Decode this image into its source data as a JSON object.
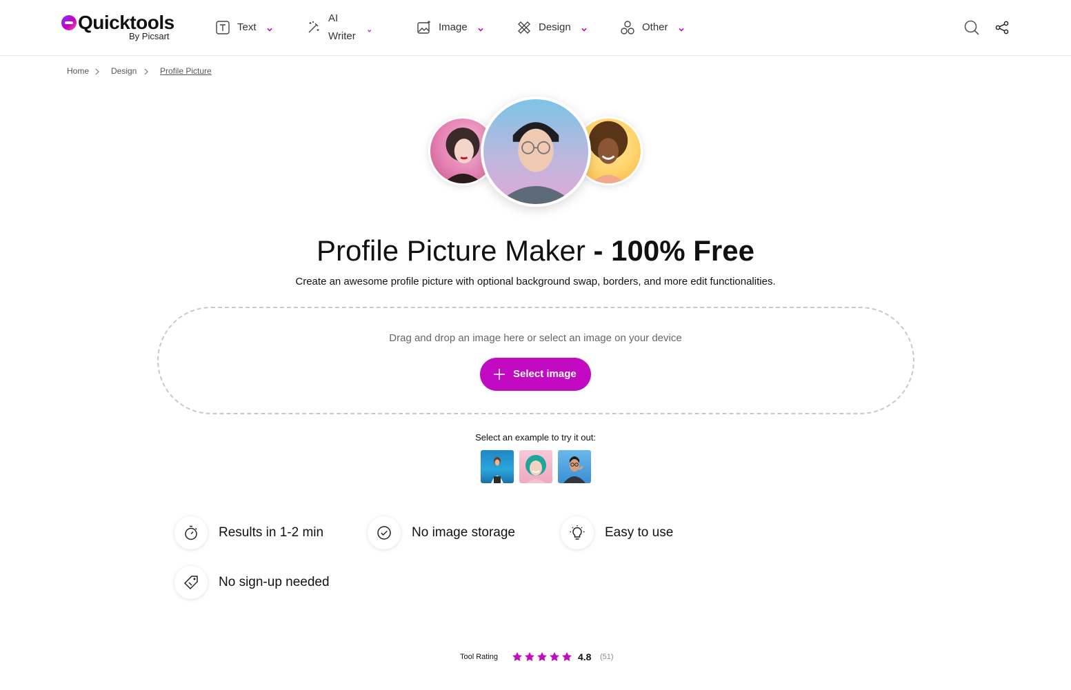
{
  "brand": {
    "name": "Quicktools",
    "sub": "By Picsart",
    "accent": "#c10ac1"
  },
  "nav": {
    "items": [
      {
        "label": "Text",
        "icon": "text-box-icon"
      },
      {
        "label": "AI Writer",
        "icon": "magic-wand-icon"
      },
      {
        "label": "Image",
        "icon": "image-sparkle-icon"
      },
      {
        "label": "Design",
        "icon": "design-tools-icon"
      },
      {
        "label": "Other",
        "icon": "shapes-icon"
      }
    ]
  },
  "header_actions": {
    "search_icon": "search-icon",
    "share_icon": "share-icon"
  },
  "breadcrumb": {
    "items": [
      "Home",
      "Design",
      "Profile Picture"
    ]
  },
  "hero": {
    "title_main": "Profile Picture Maker",
    "title_strong": " - 100% Free",
    "subtitle": "Create an awesome profile picture with optional background swap, borders, and more edit functionalities."
  },
  "upload": {
    "drop_text": "Drag and drop an image here or select an image on your device",
    "button_label": "Select image"
  },
  "examples": {
    "label": "Select an example to try it out:"
  },
  "features": [
    {
      "label": "Results in 1-2 min",
      "icon": "stopwatch-icon"
    },
    {
      "label": "No image storage",
      "icon": "check-circle-icon"
    },
    {
      "label": "Easy to use",
      "icon": "lightbulb-icon"
    },
    {
      "label": "No sign-up needed",
      "icon": "tag-icon"
    }
  ],
  "rating": {
    "label": "Tool Rating",
    "value": "4.8",
    "count": "(51)",
    "stars": 5
  }
}
